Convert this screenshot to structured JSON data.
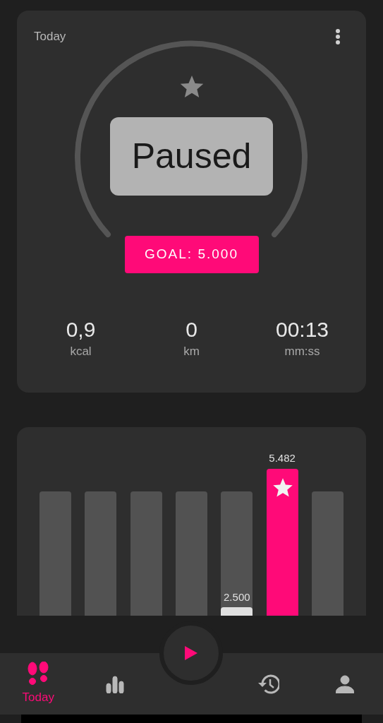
{
  "header": {
    "title": "Today"
  },
  "gauge": {
    "status": "Paused",
    "goal": "GOAL: 5.000"
  },
  "stats": [
    {
      "value": "0,9",
      "unit": "kcal"
    },
    {
      "value": "0",
      "unit": "km"
    },
    {
      "value": "00:13",
      "unit": "mm:ss"
    }
  ],
  "week_bars": [
    {
      "goal_reached": false
    },
    {
      "goal_reached": false
    },
    {
      "goal_reached": false
    },
    {
      "goal_reached": false
    },
    {
      "level": 0.07,
      "label": "2.500",
      "goal_reached": false
    },
    {
      "label": "5.482",
      "goal_reached": true
    },
    {
      "goal_reached": false
    }
  ],
  "nav": [
    {
      "kind": "today",
      "label": "Today",
      "selected": true
    },
    {
      "kind": "stats",
      "selected": false
    },
    {
      "kind": "play",
      "selected": false
    },
    {
      "kind": "history",
      "selected": false
    },
    {
      "kind": "profile",
      "selected": false
    }
  ]
}
